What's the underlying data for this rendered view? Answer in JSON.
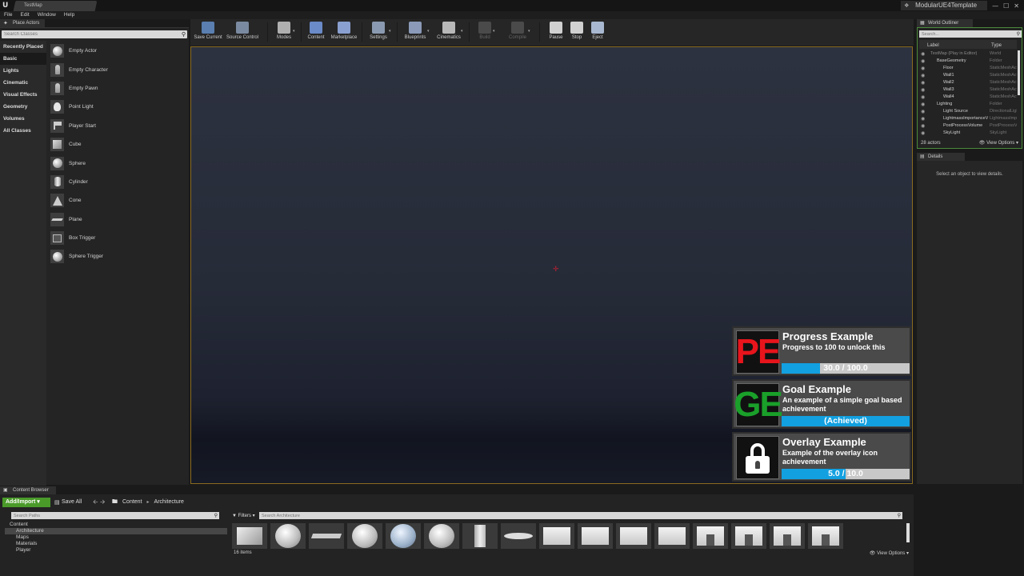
{
  "window": {
    "tab_title": "TestMap",
    "project_name": "ModularUE4Template",
    "controls": [
      "—",
      "☐",
      "✕"
    ]
  },
  "menu": [
    "File",
    "Edit",
    "Window",
    "Help"
  ],
  "place_actors": {
    "tab": "Place Actors",
    "search_placeholder": "Search Classes",
    "categories": [
      "Recently Placed",
      "Basic",
      "Lights",
      "Cinematic",
      "Visual Effects",
      "Geometry",
      "Volumes",
      "All Classes"
    ],
    "selected_category": "Basic",
    "items": [
      {
        "label": "Empty Actor",
        "icon": "sphere"
      },
      {
        "label": "Empty Character",
        "icon": "figure"
      },
      {
        "label": "Empty Pawn",
        "icon": "figure"
      },
      {
        "label": "Point Light",
        "icon": "bulb"
      },
      {
        "label": "Player Start",
        "icon": "flag"
      },
      {
        "label": "Cube",
        "icon": "cube"
      },
      {
        "label": "Sphere",
        "icon": "sphere"
      },
      {
        "label": "Cylinder",
        "icon": "cylinder"
      },
      {
        "label": "Cone",
        "icon": "cone"
      },
      {
        "label": "Plane",
        "icon": "plane"
      },
      {
        "label": "Box Trigger",
        "icon": "box"
      },
      {
        "label": "Sphere Trigger",
        "icon": "sphere"
      }
    ]
  },
  "toolbar": {
    "buttons": [
      {
        "label": "Save Current",
        "icon": "save-icon",
        "color": "#5a7fb0",
        "enabled": true
      },
      {
        "label": "Source Control",
        "icon": "source-control-icon",
        "color": "#7a8aa0",
        "enabled": true
      },
      {
        "label": "Modes",
        "icon": "modes-icon",
        "color": "#b0b0b0",
        "enabled": true
      },
      {
        "label": "Content",
        "icon": "content-icon",
        "color": "#6a8ac8",
        "enabled": true
      },
      {
        "label": "Marketplace",
        "icon": "marketplace-icon",
        "color": "#8aa0d0",
        "enabled": true
      },
      {
        "label": "Settings",
        "icon": "settings-icon",
        "color": "#8a9ab0",
        "enabled": true
      },
      {
        "label": "Blueprints",
        "icon": "blueprints-icon",
        "color": "#8a9ab8",
        "enabled": true
      },
      {
        "label": "Cinematics",
        "icon": "cinematics-icon",
        "color": "#b8b8b8",
        "enabled": true
      },
      {
        "label": "Build",
        "icon": "build-icon",
        "color": "#4a4a4a",
        "enabled": false
      },
      {
        "label": "Compile",
        "icon": "compile-icon",
        "color": "#4a4a4a",
        "enabled": false
      },
      {
        "label": "Pause",
        "icon": "pause-icon",
        "color": "#d0d0d0",
        "enabled": true
      },
      {
        "label": "Stop",
        "icon": "stop-icon",
        "color": "#d0d0d0",
        "enabled": true
      },
      {
        "label": "Eject",
        "icon": "eject-icon",
        "color": "#a8b8d0",
        "enabled": true
      }
    ]
  },
  "achievements": [
    {
      "icon_text": "PE",
      "icon_color": "#e8141c",
      "title": "Progress Example",
      "description": "Progress to 100 to unlock this",
      "bar_text": "30.0  / 100.0",
      "progress": 0.3
    },
    {
      "icon_text": "GE",
      "icon_color": "#1aa02a",
      "title": "Goal Example",
      "description": "An example of a simple goal based achievement",
      "bar_text": "(Achieved)",
      "progress": 1.0
    },
    {
      "icon_text": "",
      "icon": "lock-icon",
      "title": "Overlay Example",
      "description": "Example of the overlay icon achievement",
      "bar_text": "5.0  / 10.0",
      "progress": 0.5
    }
  ],
  "world_outliner": {
    "tab": "World Outliner",
    "search_placeholder": "Search...",
    "col_label": "Label",
    "col_type": "Type",
    "rows": [
      {
        "label": "TestMap (Play in Editor)",
        "type": "World",
        "level": 0
      },
      {
        "label": "BaseGeometry",
        "type": "Folder",
        "level": 1
      },
      {
        "label": "Floor",
        "type": "StaticMeshActor",
        "level": 2
      },
      {
        "label": "Wall1",
        "type": "StaticMeshActor",
        "level": 2
      },
      {
        "label": "Wall2",
        "type": "StaticMeshActor",
        "level": 2
      },
      {
        "label": "Wall3",
        "type": "StaticMeshActor",
        "level": 2
      },
      {
        "label": "Wall4",
        "type": "StaticMeshActor",
        "level": 2
      },
      {
        "label": "Lighting",
        "type": "Folder",
        "level": 1
      },
      {
        "label": "Light Source",
        "type": "DirectionalLight",
        "level": 2
      },
      {
        "label": "LightmassImportanceVolume",
        "type": "LightmassImportanceVolume",
        "level": 2
      },
      {
        "label": "PostProcessVolume",
        "type": "PostProcessVolume",
        "level": 2
      },
      {
        "label": "SkyLight",
        "type": "SkyLight",
        "level": 2
      }
    ],
    "actor_count": "28 actors",
    "view_options": "View Options"
  },
  "details": {
    "tab": "Details",
    "empty_text": "Select an object to view details."
  },
  "content_browser": {
    "tab": "Content Browser",
    "add_import": "Add/Import",
    "save_all": "Save All",
    "breadcrumb": [
      "Content",
      "Architecture"
    ],
    "paths_placeholder": "Search Paths",
    "tree": [
      {
        "label": "Content",
        "level": 0,
        "selected": false
      },
      {
        "label": "Architecture",
        "level": 1,
        "selected": true
      },
      {
        "label": "Maps",
        "level": 1,
        "selected": false
      },
      {
        "label": "Materials",
        "level": 1,
        "selected": false
      },
      {
        "label": "Player",
        "level": 1,
        "selected": false
      }
    ],
    "filters": "Filters",
    "assets_placeholder": "Search Architecture",
    "assets": [
      "cube",
      "sphere",
      "flat",
      "sphere",
      "sphere2",
      "sphere",
      "pillar",
      "disc",
      "wall",
      "wall",
      "wall",
      "wall",
      "door",
      "door",
      "door",
      "door"
    ],
    "item_count": "16 items",
    "view_options": "View Options"
  }
}
